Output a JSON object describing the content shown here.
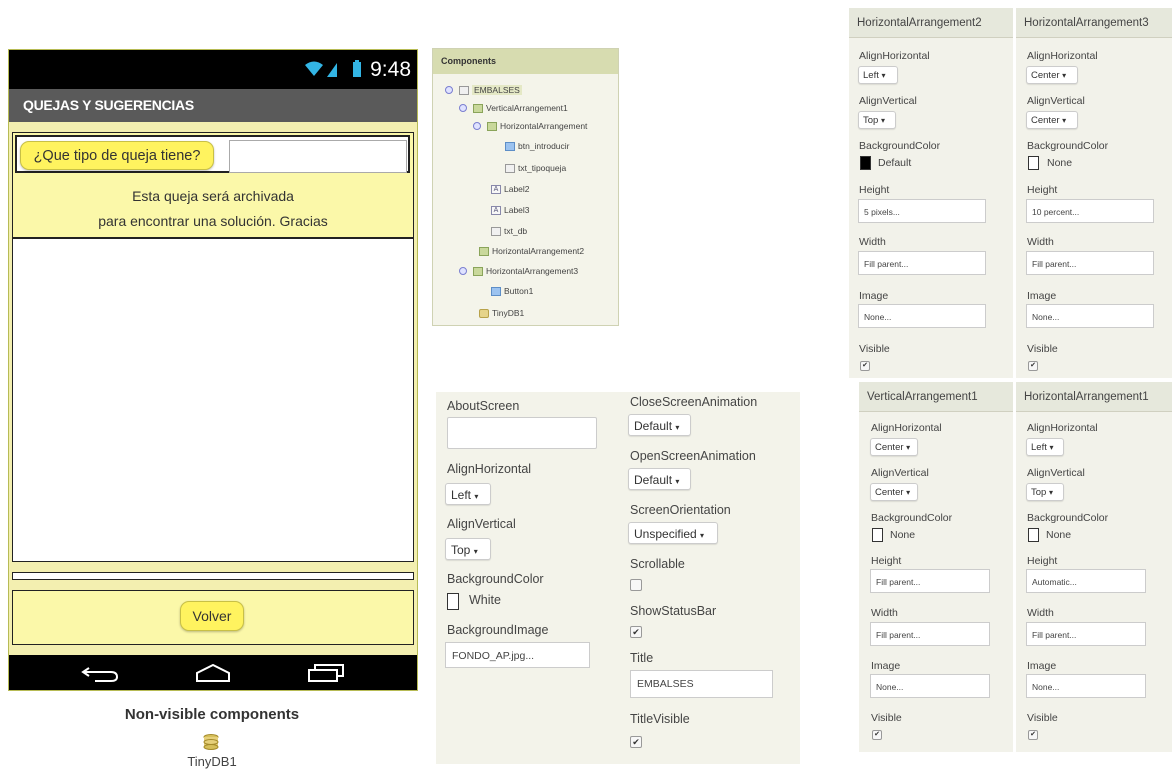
{
  "phone": {
    "status_time": "9:48",
    "status_icons": "wifi-signal-battery",
    "title": "QUEJAS Y SUGERENCIAS",
    "button_question": "¿Que tipo de queja tiene?",
    "textbox_value": "",
    "label2": "Esta queja será archivada",
    "label3": "para encontrar una solución. Gracias",
    "button_back": "Volver",
    "nav_icons": [
      "back-icon",
      "home-icon",
      "recents-icon"
    ],
    "nonvisible_title": "Non-visible components",
    "nonvisible_item": "TinyDB1",
    "colors": {
      "background": "#f3efb0",
      "button": "#fff35f",
      "statusbar": "#000000",
      "titlebar": "#5a5a5a"
    }
  },
  "components": {
    "header": "Components",
    "items": [
      {
        "label": "EMBALSES",
        "icon": "screen-icon",
        "selected": true
      },
      {
        "label": "VerticalArrangement1",
        "icon": "vertical-arrangement-icon"
      },
      {
        "label": "HorizontalArrangement",
        "icon": "horizontal-arrangement-icon"
      },
      {
        "label": "btn_introducir",
        "icon": "button-icon"
      },
      {
        "label": "txt_tipoqueja",
        "icon": "textbox-icon"
      },
      {
        "label": "Label2",
        "icon": "label-icon"
      },
      {
        "label": "Label3",
        "icon": "label-icon"
      },
      {
        "label": "txt_db",
        "icon": "textbox-icon"
      },
      {
        "label": "HorizontalArrangement2",
        "icon": "horizontal-arrangement-icon"
      },
      {
        "label": "HorizontalArrangement3",
        "icon": "horizontal-arrangement-icon"
      },
      {
        "label": "Button1",
        "icon": "button-icon"
      },
      {
        "label": "TinyDB1",
        "icon": "tinydb-icon"
      }
    ]
  },
  "screen_props": {
    "about_label": "AboutScreen",
    "about_value": "",
    "alignh_label": "AlignHorizontal",
    "alignh_value": "Left",
    "alignv_label": "AlignVertical",
    "alignv_value": "Top",
    "bgcolor_label": "BackgroundColor",
    "bgcolor_value": "White",
    "bgimage_label": "BackgroundImage",
    "bgimage_value": "FONDO_AP.jpg...",
    "close_anim_label": "CloseScreenAnimation",
    "close_anim_value": "Default",
    "open_anim_label": "OpenScreenAnimation",
    "open_anim_value": "Default",
    "orientation_label": "ScreenOrientation",
    "orientation_value": "Unspecified",
    "scrollable_label": "Scrollable",
    "scrollable_checked": false,
    "statusbar_label": "ShowStatusBar",
    "statusbar_checked": true,
    "title_label": "Title",
    "title_value": "EMBALSES",
    "titlevisible_label": "TitleVisible",
    "titlevisible_checked": true
  },
  "labels": {
    "align_h": "AlignHorizontal",
    "align_v": "AlignVertical",
    "bgcolor": "BackgroundColor",
    "height": "Height",
    "width": "Width",
    "image": "Image",
    "visible": "Visible"
  },
  "panels": [
    {
      "title": "HorizontalArrangement2",
      "align_h": "Left",
      "align_v": "Top",
      "bgcolor": "Default",
      "bgcolor_hex": "#000000",
      "height": "5 pixels...",
      "width": "Fill parent...",
      "image": "None...",
      "visible": true
    },
    {
      "title": "HorizontalArrangement3",
      "align_h": "Center",
      "align_v": "Center",
      "bgcolor": "None",
      "bgcolor_hex": "#ffffff",
      "height": "10 percent...",
      "width": "Fill parent...",
      "image": "None...",
      "visible": true
    },
    {
      "title": "VerticalArrangement1",
      "align_h": "Center",
      "align_v": "Center",
      "bgcolor": "None",
      "bgcolor_hex": "#ffffff",
      "height": "Fill parent...",
      "width": "Fill parent...",
      "image": "None...",
      "visible": true
    },
    {
      "title": "HorizontalArrangement1",
      "align_h": "Left",
      "align_v": "Top",
      "bgcolor": "None",
      "bgcolor_hex": "#ffffff",
      "height": "Automatic...",
      "width": "Fill parent...",
      "image": "None...",
      "visible": true
    }
  ]
}
